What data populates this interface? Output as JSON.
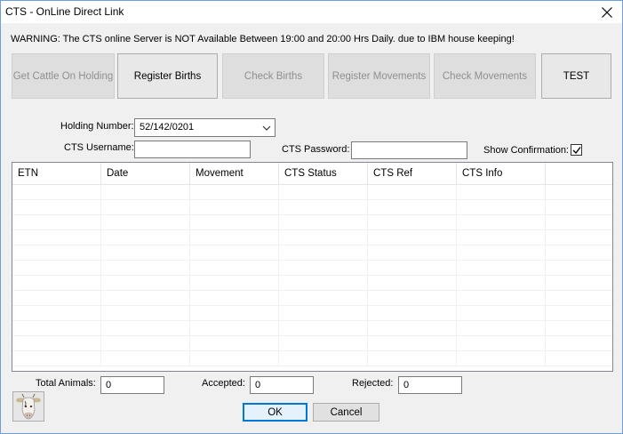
{
  "window": {
    "title": "CTS - OnLine Direct Link"
  },
  "warning": "WARNING: The CTS online Server is NOT Available Between 19:00 and 20:00 Hrs Daily. due to IBM house keeping!",
  "toolbar": {
    "get_cattle": "Get Cattle On Holding",
    "register_births": "Register Births",
    "check_births": "Check Births",
    "register_movements": "Register Movements",
    "check_movements": "Check Movements",
    "test": "TEST"
  },
  "form": {
    "holding_label": "Holding Number:",
    "holding_value": "52/142/0201",
    "username_label": "CTS Username:",
    "username_value": "",
    "password_label": "CTS Password:",
    "password_value": "",
    "show_confirmation_label": "Show Confirmation:",
    "show_confirmation_checked": true
  },
  "grid": {
    "columns": [
      "ETN",
      "Date",
      "Movement",
      "CTS Status",
      "CTS Ref",
      "CTS Info"
    ],
    "rows": []
  },
  "totals": {
    "total_label": "Total Animals:",
    "total_value": "0",
    "accepted_label": "Accepted:",
    "accepted_value": "0",
    "rejected_label": "Rejected:",
    "rejected_value": "0"
  },
  "buttons": {
    "ok": "OK",
    "cancel": "Cancel"
  },
  "icons": {
    "close": "close-icon",
    "dropdown": "chevron-down-icon",
    "check": "checkmark-icon",
    "cow": "cow-icon"
  },
  "colors": {
    "window_border": "#6f9fd6",
    "ok_border": "#0078d7",
    "disabled_text": "#8f8f8f"
  }
}
